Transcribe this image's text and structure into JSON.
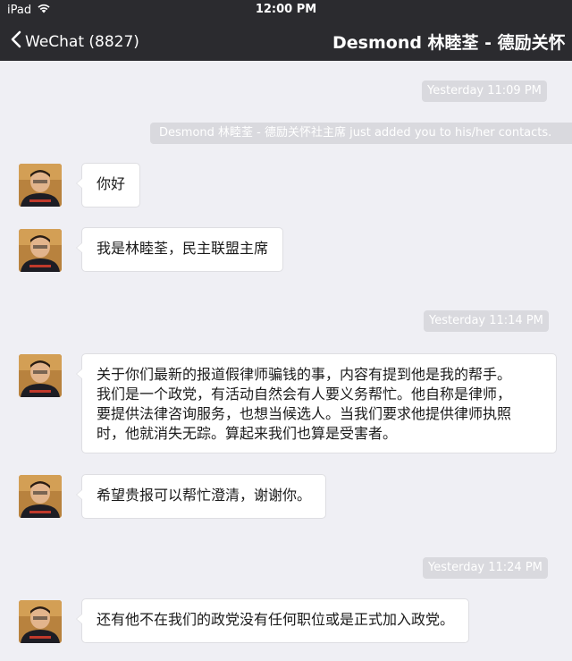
{
  "status_bar": {
    "device": "iPad",
    "time": "12:00 PM"
  },
  "nav": {
    "back_label": "WeChat (8827)",
    "title": "Desmond 林睦荃 - 德励关怀"
  },
  "icons": {
    "wifi": "wifi-icon",
    "back": "chevron-left-icon",
    "avatar": "contact-avatar"
  },
  "colors": {
    "nav_background": "#2b2b2f",
    "chat_background": "#efeff4",
    "timestamp_pill": "#d9d9de",
    "bubble": "#ffffff"
  },
  "timestamps": [
    "Yesterday 11:09 PM",
    "Yesterday 11:14 PM",
    "Yesterday 11:24 PM"
  ],
  "system_message": "Desmond 林睦荃 - 德励关怀社主席 just added you to his/her contacts.",
  "messages": [
    {
      "text": "你好"
    },
    {
      "text": "我是林睦荃，民主联盟主席"
    },
    {
      "lines": [
        "关于你们最新的报道假律师骗钱的事，内容有提到他是我的帮手。",
        "我们是一个政党，有活动自然会有人要义务帮忙。他自称是律师，",
        "要提供法律咨询服务，也想当候选人。当我们要求他提供律师执照",
        "时，他就消失无踪。算起来我们也算是受害者。"
      ]
    },
    {
      "text": "希望贵报可以帮忙澄清，谢谢你。"
    },
    {
      "text": "还有他不在我们的政党没有任何职位或是正式加入政党。"
    }
  ]
}
